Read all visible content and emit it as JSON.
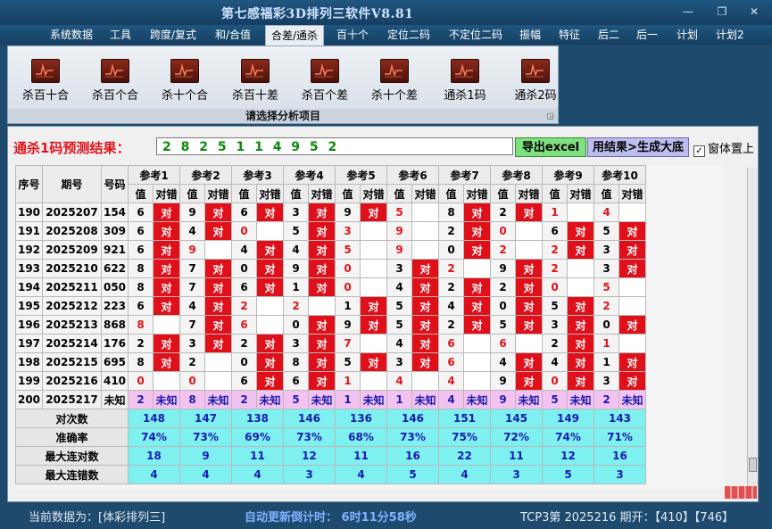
{
  "window": {
    "title": "第七感福彩3D排列三软件V8.81",
    "buttons": [
      "—",
      "❐",
      "✕"
    ]
  },
  "menu": [
    {
      "label": "系统数据"
    },
    {
      "label": "工具"
    },
    {
      "label": "跨度/复式"
    },
    {
      "label": "和/合值"
    },
    {
      "label": "合差/通杀",
      "active": true
    },
    {
      "label": "百十个"
    },
    {
      "label": "定位二码"
    },
    {
      "label": "不定位二码"
    },
    {
      "label": "振幅"
    },
    {
      "label": "特征"
    },
    {
      "label": "后二"
    },
    {
      "label": "后一"
    },
    {
      "label": "计划"
    },
    {
      "label": "计划2"
    }
  ],
  "ribbon": {
    "buttons": [
      {
        "label": "杀百十合",
        "icon": "chart-icon"
      },
      {
        "label": "杀百个合",
        "icon": "chart-icon"
      },
      {
        "label": "杀十个合",
        "icon": "chart-icon"
      },
      {
        "label": "杀百十差",
        "icon": "chart-icon"
      },
      {
        "label": "杀百个差",
        "icon": "chart-icon"
      },
      {
        "label": "杀十个差",
        "icon": "chart-icon"
      },
      {
        "label": "通杀1码",
        "icon": "chart-icon"
      },
      {
        "label": "通杀2码",
        "icon": "chart-icon"
      }
    ],
    "caption": "请选择分析项目"
  },
  "prediction": {
    "label": "通杀1码预测结果：",
    "value": "2 8 2 5 1 1 4 9 5 2",
    "export_label": "导出excel",
    "generate_label": "用结果>生成大底",
    "topmost_label": "窗体置上",
    "topmost_checked": true
  },
  "table": {
    "headers": {
      "seq": "序号",
      "period": "期号",
      "number": "号码",
      "refs": [
        "参考1",
        "参考2",
        "参考3",
        "参考4",
        "参考5",
        "参考6",
        "参考7",
        "参考8",
        "参考9",
        "参考10"
      ],
      "sub_value": "值",
      "sub_result": "对错"
    },
    "ok_text": "对",
    "rows": [
      {
        "seq": "190",
        "period": "2025207",
        "number": "154",
        "vals": [
          "6",
          "9",
          "6",
          "3",
          "9",
          "5",
          "8",
          "2",
          "1",
          "4"
        ],
        "oks": [
          1,
          1,
          1,
          1,
          1,
          0,
          1,
          1,
          0,
          0
        ],
        "reds": [
          0,
          0,
          0,
          0,
          0,
          1,
          0,
          0,
          1,
          1
        ]
      },
      {
        "seq": "191",
        "period": "2025208",
        "number": "309",
        "vals": [
          "6",
          "4",
          "0",
          "5",
          "3",
          "9",
          "2",
          "0",
          "6",
          "5"
        ],
        "oks": [
          1,
          1,
          0,
          1,
          0,
          0,
          1,
          0,
          1,
          1
        ],
        "reds": [
          0,
          0,
          1,
          0,
          1,
          1,
          0,
          1,
          0,
          0
        ]
      },
      {
        "seq": "192",
        "period": "2025209",
        "number": "921",
        "vals": [
          "6",
          "9",
          "4",
          "4",
          "5",
          "9",
          "0",
          "2",
          "2",
          "3"
        ],
        "oks": [
          1,
          0,
          1,
          1,
          0,
          0,
          1,
          0,
          1,
          1
        ],
        "reds": [
          0,
          1,
          0,
          0,
          1,
          1,
          0,
          1,
          1,
          0
        ]
      },
      {
        "seq": "193",
        "period": "2025210",
        "number": "622",
        "vals": [
          "8",
          "7",
          "0",
          "9",
          "0",
          "3",
          "2",
          "9",
          "2",
          "3"
        ],
        "oks": [
          1,
          1,
          1,
          1,
          0,
          1,
          0,
          1,
          0,
          1
        ],
        "reds": [
          0,
          0,
          0,
          0,
          1,
          0,
          1,
          0,
          1,
          0
        ]
      },
      {
        "seq": "194",
        "period": "2025211",
        "number": "050",
        "vals": [
          "8",
          "7",
          "6",
          "1",
          "0",
          "4",
          "2",
          "2",
          "0",
          "5"
        ],
        "oks": [
          1,
          1,
          1,
          1,
          0,
          1,
          1,
          1,
          0,
          0
        ],
        "reds": [
          0,
          0,
          0,
          0,
          1,
          0,
          0,
          0,
          1,
          1
        ]
      },
      {
        "seq": "195",
        "period": "2025212",
        "number": "223",
        "vals": [
          "6",
          "4",
          "2",
          "2",
          "1",
          "5",
          "4",
          "0",
          "5",
          "2"
        ],
        "oks": [
          1,
          1,
          0,
          0,
          1,
          1,
          1,
          1,
          1,
          0
        ],
        "reds": [
          0,
          0,
          1,
          1,
          0,
          0,
          0,
          0,
          0,
          1
        ]
      },
      {
        "seq": "196",
        "period": "2025213",
        "number": "868",
        "vals": [
          "8",
          "7",
          "6",
          "0",
          "9",
          "5",
          "2",
          "5",
          "3",
          "0"
        ],
        "oks": [
          0,
          1,
          0,
          1,
          1,
          1,
          1,
          1,
          1,
          1
        ],
        "reds": [
          1,
          0,
          1,
          0,
          0,
          0,
          0,
          0,
          0,
          0
        ]
      },
      {
        "seq": "197",
        "period": "2025214",
        "number": "176",
        "vals": [
          "2",
          "3",
          "2",
          "3",
          "7",
          "4",
          "6",
          "6",
          "2",
          "1"
        ],
        "oks": [
          1,
          1,
          1,
          1,
          0,
          1,
          0,
          0,
          1,
          0
        ],
        "reds": [
          0,
          0,
          0,
          0,
          1,
          0,
          1,
          1,
          0,
          1
        ]
      },
      {
        "seq": "198",
        "period": "2025215",
        "number": "695",
        "vals": [
          "8",
          "2",
          "0",
          "8",
          "5",
          "3",
          "6",
          "4",
          "4",
          "1"
        ],
        "oks": [
          1,
          0,
          1,
          1,
          1,
          1,
          0,
          1,
          1,
          1
        ],
        "reds": [
          0,
          0,
          0,
          0,
          0,
          0,
          1,
          0,
          0,
          0
        ]
      },
      {
        "seq": "199",
        "period": "2025216",
        "number": "410",
        "vals": [
          "0",
          "0",
          "6",
          "6",
          "1",
          "4",
          "4",
          "9",
          "0",
          "3"
        ],
        "oks": [
          0,
          0,
          1,
          1,
          0,
          0,
          0,
          1,
          1,
          1
        ],
        "reds": [
          1,
          1,
          0,
          0,
          1,
          1,
          1,
          0,
          1,
          0
        ]
      }
    ],
    "future": {
      "seq": "200",
      "period": "2025217",
      "number": "未知",
      "vals": [
        "2",
        "8",
        "2",
        "5",
        "1",
        "1",
        "4",
        "9",
        "5",
        "2"
      ],
      "result": "未知"
    },
    "stats": [
      {
        "label": "对次数",
        "vals": [
          "148",
          "147",
          "138",
          "146",
          "136",
          "146",
          "151",
          "145",
          "149",
          "143"
        ]
      },
      {
        "label": "准确率",
        "vals": [
          "74%",
          "73%",
          "69%",
          "73%",
          "68%",
          "73%",
          "75%",
          "72%",
          "74%",
          "71%"
        ]
      },
      {
        "label": "最大连对数",
        "vals": [
          "18",
          "9",
          "11",
          "12",
          "11",
          "16",
          "22",
          "11",
          "12",
          "16"
        ]
      },
      {
        "label": "最大连错数",
        "vals": [
          "4",
          "4",
          "4",
          "3",
          "4",
          "5",
          "4",
          "3",
          "5",
          "3"
        ]
      }
    ]
  },
  "status": {
    "source": "当前数据为：[体彩排列三]",
    "countdown": "自动更新倒计时：  6时11分58秒",
    "tcp": "TCP3第 2025216 期开：【410】【746】"
  }
}
